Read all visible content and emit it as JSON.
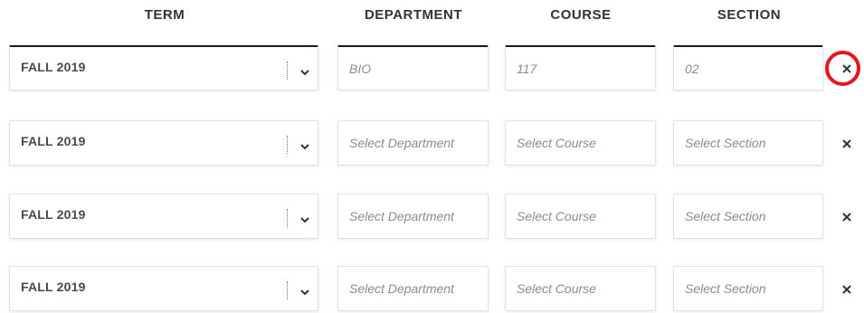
{
  "headers": {
    "term": "TERM",
    "department": "DEPARTMENT",
    "course": "COURSE",
    "section": "SECTION"
  },
  "rows": [
    {
      "term": "FALL 2019",
      "department": "BIO",
      "course": "117",
      "section": "02",
      "active": true
    },
    {
      "term": "FALL 2019",
      "department": "Select Department",
      "course": "Select Course",
      "section": "Select Section",
      "active": false
    },
    {
      "term": "FALL 2019",
      "department": "Select Department",
      "course": "Select Course",
      "section": "Select Section",
      "active": false
    },
    {
      "term": "FALL 2019",
      "department": "Select Department",
      "course": "Select Course",
      "section": "Select Section",
      "active": false
    }
  ],
  "icons": {
    "dropdown": "chevron-down-icon",
    "remove": "close-icon",
    "highlight": "red-circle-annotation"
  },
  "colors": {
    "highlight": "#e8141c",
    "header_text": "#333333",
    "placeholder": "#8c8c8c",
    "active_border": "#1a1a1a"
  }
}
